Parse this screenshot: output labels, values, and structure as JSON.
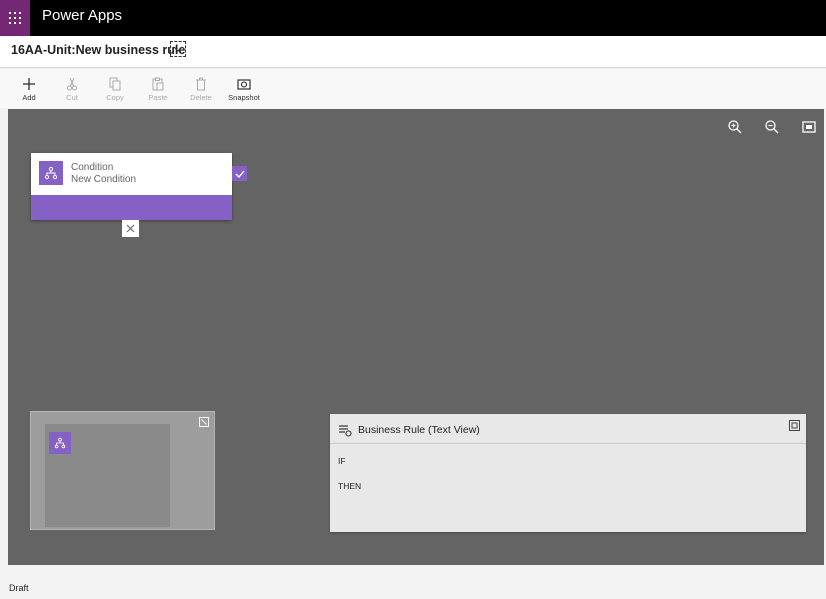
{
  "app": {
    "name": "Power Apps"
  },
  "rule": {
    "title": "16AA-Unit:New business rule"
  },
  "toolbar": {
    "add": "Add",
    "cut": "Cut",
    "copy": "Copy",
    "paste": "Paste",
    "delete": "Delete",
    "snapshot": "Snapshot"
  },
  "canvas": {
    "condition": {
      "type": "Condition",
      "name": "New Condition"
    }
  },
  "text_view": {
    "title": "Business Rule (Text View)",
    "if_label": "IF",
    "then_label": "THEN"
  },
  "status": {
    "text": "Draft"
  },
  "colors": {
    "brand_purple": "#742774",
    "node_purple": "#8661c5",
    "canvas_bg": "#646464"
  },
  "icons": [
    "waffle-icon",
    "chevron-down-icon",
    "plus-icon",
    "scissors-icon",
    "copy-icon",
    "paste-icon",
    "trash-icon",
    "camera-icon",
    "zoom-in-icon",
    "zoom-out-icon",
    "fit-screen-icon",
    "condition-icon",
    "check-icon",
    "close-icon",
    "expand-icon",
    "text-view-icon"
  ]
}
